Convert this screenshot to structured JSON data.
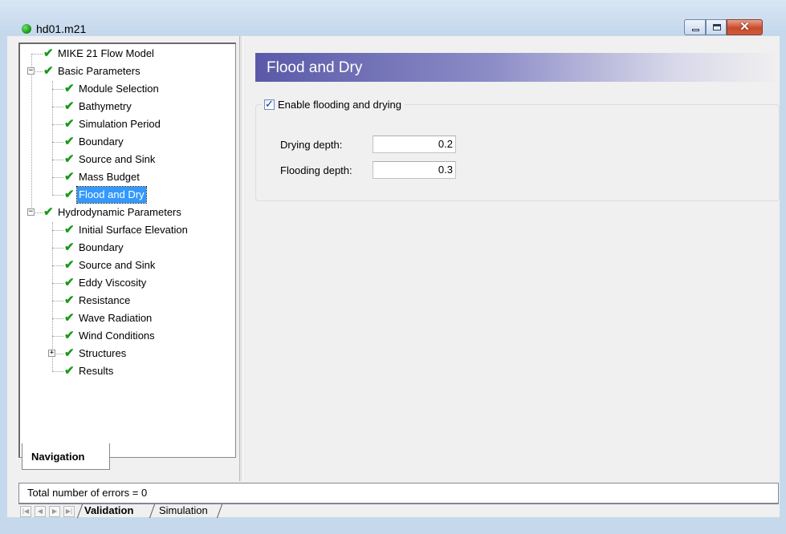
{
  "window": {
    "title": "hd01.m21",
    "controls": {
      "minimize": "–",
      "maximize": "□",
      "close": "✕"
    }
  },
  "tree": {
    "items": [
      {
        "label": "MIKE 21 Flow Model",
        "level": 0,
        "expander": ""
      },
      {
        "label": "Basic Parameters",
        "level": 0,
        "expander": "−"
      },
      {
        "label": "Module Selection",
        "level": 1,
        "expander": ""
      },
      {
        "label": "Bathymetry",
        "level": 1,
        "expander": ""
      },
      {
        "label": "Simulation Period",
        "level": 1,
        "expander": ""
      },
      {
        "label": "Boundary",
        "level": 1,
        "expander": ""
      },
      {
        "label": "Source and Sink",
        "level": 1,
        "expander": ""
      },
      {
        "label": "Mass Budget",
        "level": 1,
        "expander": ""
      },
      {
        "label": "Flood and Dry",
        "level": 1,
        "expander": "",
        "selected": true
      },
      {
        "label": "Hydrodynamic Parameters",
        "level": 0,
        "expander": "−"
      },
      {
        "label": "Initial Surface Elevation",
        "level": 1,
        "expander": ""
      },
      {
        "label": "Boundary",
        "level": 1,
        "expander": ""
      },
      {
        "label": "Source and Sink",
        "level": 1,
        "expander": ""
      },
      {
        "label": "Eddy Viscosity",
        "level": 1,
        "expander": ""
      },
      {
        "label": "Resistance",
        "level": 1,
        "expander": ""
      },
      {
        "label": "Wave Radiation",
        "level": 1,
        "expander": ""
      },
      {
        "label": "Wind Conditions",
        "level": 1,
        "expander": ""
      },
      {
        "label": "Structures",
        "level": 1,
        "expander": "+"
      },
      {
        "label": "Results",
        "level": 1,
        "expander": ""
      }
    ],
    "check_glyph": "✔",
    "check_color": "#1a9a1a",
    "selected_color": "#3399ff"
  },
  "nav_tab": {
    "label": "Navigation"
  },
  "page": {
    "header": "Flood and Dry",
    "header_color": "#5a59a8",
    "enable_label": "Enable flooding and drying",
    "enable_checked": true,
    "drying_label": "Drying depth:",
    "drying_value": "0.2",
    "flooding_label": "Flooding depth:",
    "flooding_value": "0.3"
  },
  "validation": {
    "message": "Total number of errors = 0",
    "tabs": {
      "active": "Validation",
      "other": "Simulation"
    },
    "nav_buttons": [
      "first",
      "prev",
      "next",
      "last"
    ]
  }
}
